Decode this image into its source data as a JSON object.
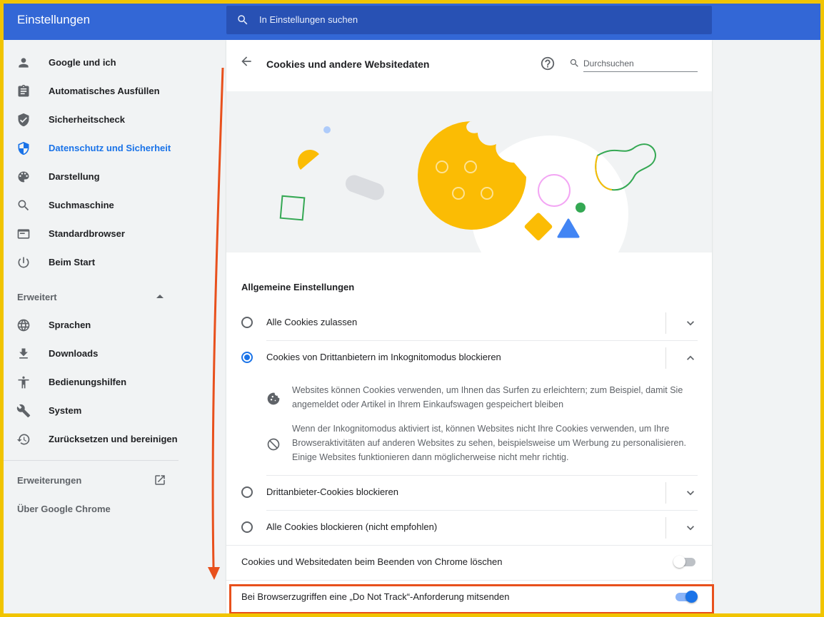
{
  "app": {
    "title": "Einstellungen",
    "search_placeholder": "In Einstellungen suchen"
  },
  "sidebar": {
    "items": [
      {
        "label": "Google und ich",
        "icon": "person-icon"
      },
      {
        "label": "Automatisches Ausfüllen",
        "icon": "clipboard-icon"
      },
      {
        "label": "Sicherheitscheck",
        "icon": "shield-check-icon"
      },
      {
        "label": "Datenschutz und Sicherheit",
        "icon": "shield-icon",
        "active": true
      },
      {
        "label": "Darstellung",
        "icon": "palette-icon"
      },
      {
        "label": "Suchmaschine",
        "icon": "search-icon"
      },
      {
        "label": "Standardbrowser",
        "icon": "browser-icon"
      },
      {
        "label": "Beim Start",
        "icon": "power-icon"
      }
    ],
    "advanced_label": "Erweitert",
    "advanced_items": [
      {
        "label": "Sprachen",
        "icon": "globe-icon"
      },
      {
        "label": "Downloads",
        "icon": "download-icon"
      },
      {
        "label": "Bedienungshilfen",
        "icon": "accessibility-icon"
      },
      {
        "label": "System",
        "icon": "wrench-icon"
      },
      {
        "label": "Zurücksetzen und bereinigen",
        "icon": "restore-icon"
      }
    ],
    "extensions_label": "Erweiterungen",
    "about_label": "Über Google Chrome"
  },
  "panel": {
    "title": "Cookies und andere Websitedaten",
    "search_placeholder": "Durchsuchen",
    "general_heading": "Allgemeine Einstellungen",
    "options": [
      {
        "label": "Alle Cookies zulassen",
        "selected": false,
        "expanded": false
      },
      {
        "label": "Cookies von Drittanbietern im Inkognitomodus blockieren",
        "selected": true,
        "expanded": true
      },
      {
        "label": "Drittanbieter-Cookies blockieren",
        "selected": false,
        "expanded": false
      },
      {
        "label": "Alle Cookies blockieren (nicht empfohlen)",
        "selected": false,
        "expanded": false
      }
    ],
    "desc1": "Websites können Cookies verwenden, um Ihnen das Surfen zu erleichtern; zum Beispiel, damit Sie angemeldet oder Artikel in Ihrem Einkaufswagen gespeichert bleiben",
    "desc2": "Wenn der Inkognitomodus aktiviert ist, können Websites nicht Ihre Cookies verwenden, um Ihre Browseraktivitäten auf anderen Websites zu sehen, beispielsweise um Werbung zu personalisieren. Einige Websites funktionieren dann möglicherweise nicht mehr richtig.",
    "clear_on_exit_label": "Cookies und Websitedaten beim Beenden von Chrome löschen",
    "clear_on_exit_on": false,
    "dnt_label": "Bei Browserzugriffen eine „Do Not Track“-Anforderung mitsenden",
    "dnt_on": true
  },
  "colors": {
    "accent": "#1a73e8",
    "header": "#3367d6",
    "highlight": "#e8501c",
    "frame": "#f1c400"
  }
}
